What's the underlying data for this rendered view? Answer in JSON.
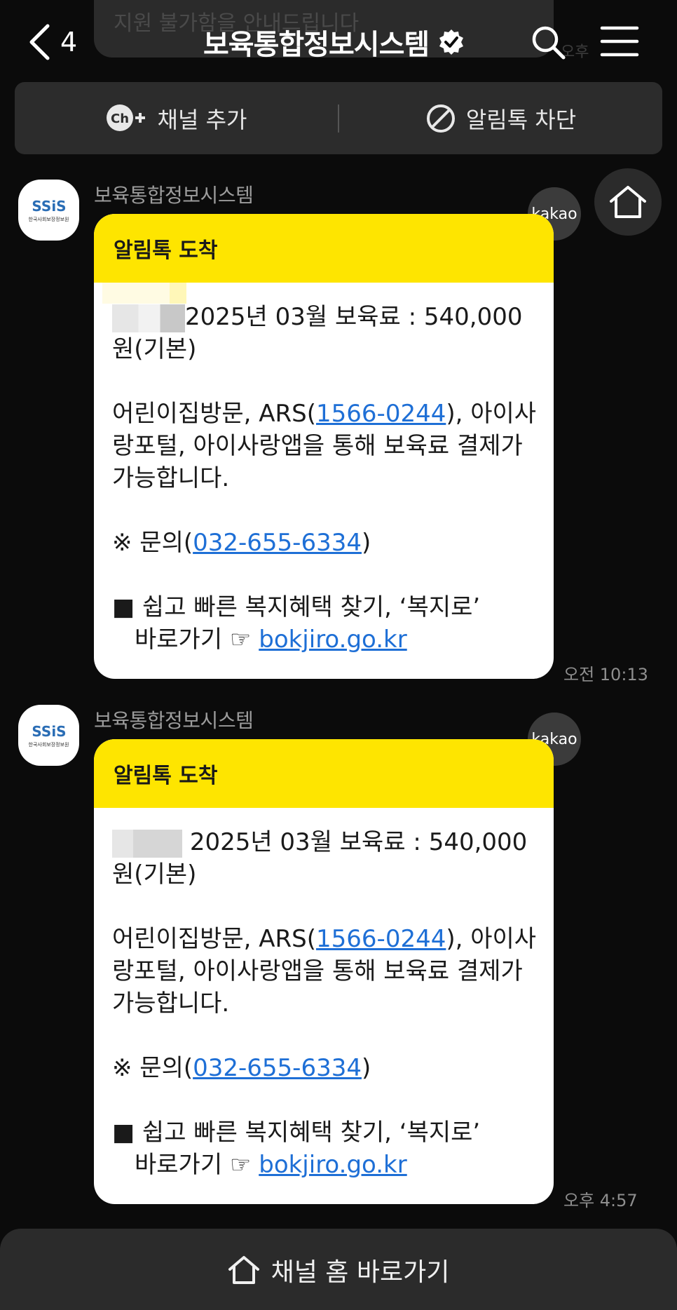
{
  "previous_message": {
    "text_fragment": "지원 불가함을 안내드립니다",
    "time_fragment": "오후"
  },
  "header": {
    "back_count": "4",
    "title": "보육통합정보시스템",
    "verified_icon": "verified-badge-icon",
    "search_icon": "search-icon",
    "menu_icon": "menu-icon"
  },
  "channel_bar": {
    "add_channel_label": "채널 추가",
    "block_label": "알림톡 차단"
  },
  "messages": [
    {
      "sender": "보육통합정보시스템",
      "avatar_logo": "SSiS",
      "avatar_sub": "한국사회보장정보원",
      "header": "알림톡 도착",
      "line1": "2025년 03월 보육료 : 540,000 원(기본)",
      "para2_before": "어린이집방문, ARS(",
      "phone_ars": "1566-0244",
      "para2_after": "), 아이사랑포털, 아이사랑앱을 통해 보육료 결제가 가능합니다.",
      "inquiry_before": "※ 문의(",
      "phone_inquiry": "032-655-6334",
      "inquiry_after": ")",
      "bokjiro_line1": "■ 쉽고 빠른 복지혜택 찾기, ‘복지로’",
      "bokjiro_line2": "바로가기 ☞",
      "bokjiro_link": "bokjiro.go.kr",
      "badge": "kakao",
      "time": "오전 10:13"
    },
    {
      "sender": "보육통합정보시스템",
      "avatar_logo": "SSiS",
      "avatar_sub": "한국사회보장정보원",
      "header": "알림톡 도착",
      "line1": "2025년 03월 보육료 : 540,000 원(기본)",
      "para2_before": "어린이집방문, ARS(",
      "phone_ars": "1566-0244",
      "para2_after": "), 아이사랑포털, 아이사랑앱을 통해 보육료 결제가 가능합니다.",
      "inquiry_before": "※ 문의(",
      "phone_inquiry": "032-655-6334",
      "inquiry_after": ")",
      "bokjiro_line1": "■ 쉽고 빠른 복지혜택 찾기, ‘복지로’",
      "bokjiro_line2": "바로가기 ☞",
      "bokjiro_link": "bokjiro.go.kr",
      "badge": "kakao",
      "time": "오후 4:57"
    }
  ],
  "bottom_bar": {
    "label": "채널 홈 바로가기"
  },
  "colors": {
    "background": "#0b0b0b",
    "bubble_header": "#fee500",
    "link": "#1e6fd6",
    "panel": "#2c2c2c"
  }
}
